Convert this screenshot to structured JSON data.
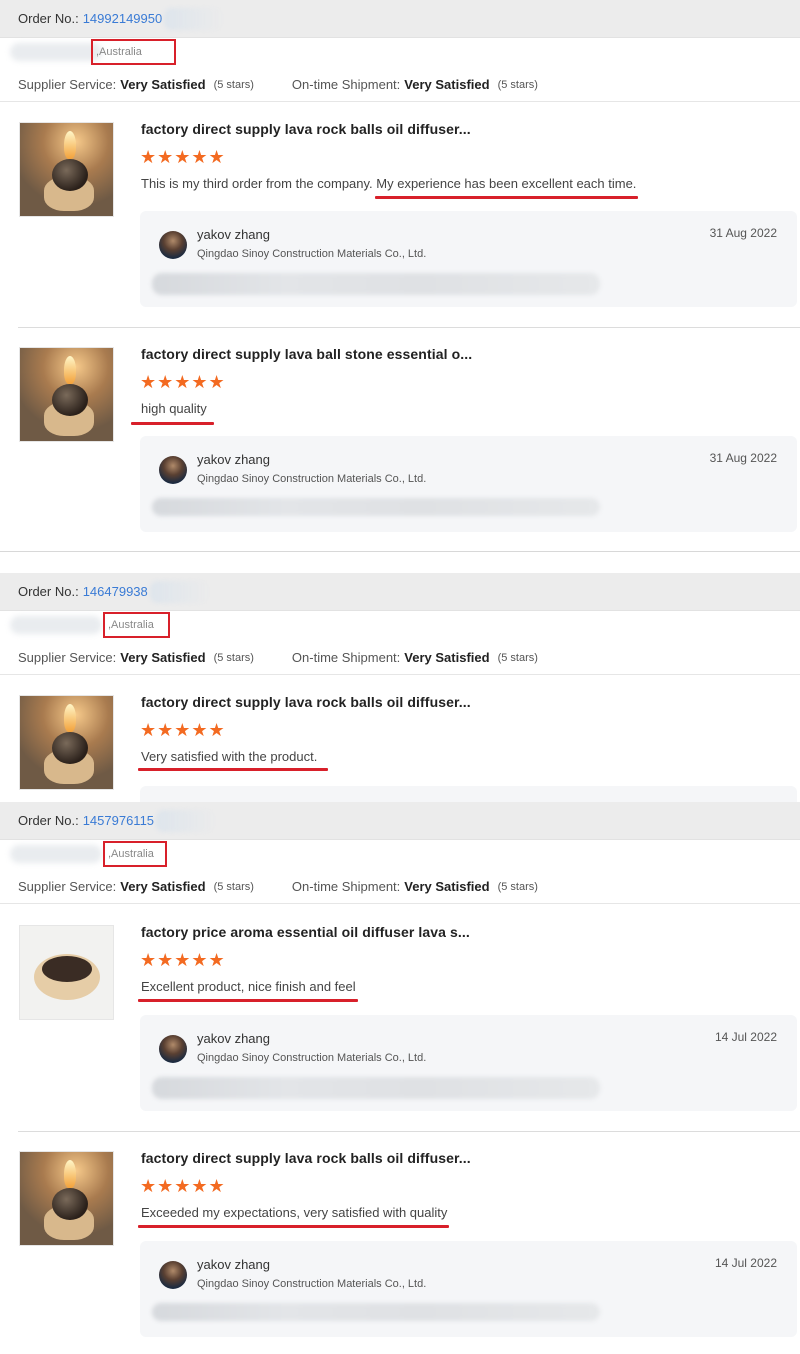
{
  "common": {
    "order_label": "Order No.: ",
    "location": ",Australia",
    "supplier_label": "Supplier Service:",
    "shipment_label": "On-time Shipment:",
    "rating_word": "Very Satisfied",
    "stars_text": "(5 stars)",
    "star_glyphs": "★★★★★",
    "replier_name": "yakov zhang",
    "replier_company": "Qingdao Sinoy Construction Materials Co., Ltd.",
    "accent_color": "#f36a21",
    "highlight_color": "#d8202a",
    "link_color": "#3a7bd5"
  },
  "orders": [
    {
      "order_number": "14992149950",
      "reviews": [
        {
          "title": "factory direct supply lava rock balls oil diffuser...",
          "text": "This is my third order from the company. My experience has been excellent each time.",
          "reply_date": "31 Aug 2022"
        },
        {
          "title": "factory direct supply lava ball stone essential o...",
          "text": "high quality",
          "reply_date": "31 Aug 2022"
        }
      ]
    },
    {
      "order_number": "146479938",
      "reviews": [
        {
          "title": "factory direct supply lava rock balls oil diffuser...",
          "text": "Very satisfied with the product."
        }
      ]
    },
    {
      "order_number": "1457976115",
      "reviews": [
        {
          "title": "factory price aroma essential oil diffuser lava s...",
          "text": "Excellent product, nice finish and feel",
          "reply_date": "14 Jul 2022"
        },
        {
          "title": "factory direct supply lava rock balls oil diffuser...",
          "text": "Exceeded my expectations, very satisfied with quality",
          "reply_date": "14 Jul 2022"
        }
      ]
    }
  ]
}
